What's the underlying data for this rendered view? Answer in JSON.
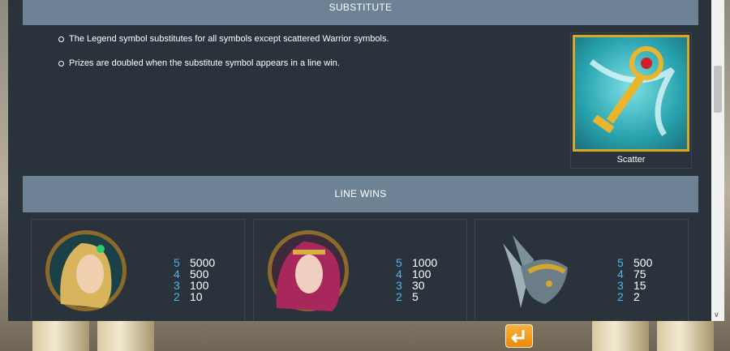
{
  "substitute": {
    "heading": "SUBSTITUTE",
    "rules": [
      "The Legend symbol substitutes for all symbols except scattered Warrior symbols.",
      "Prizes are doubled when the substitute symbol appears in a line win."
    ],
    "scatter_caption": "Scatter",
    "scatter_icon": "golden-key-icon"
  },
  "line_wins": {
    "heading": "LINE WINS",
    "symbols": [
      {
        "icon": "blonde-elf-warrior-icon",
        "pays": [
          {
            "count": "5",
            "value": "5000"
          },
          {
            "count": "4",
            "value": "500"
          },
          {
            "count": "3",
            "value": "100"
          },
          {
            "count": "2",
            "value": "10"
          }
        ]
      },
      {
        "icon": "crimson-haired-queen-icon",
        "pays": [
          {
            "count": "5",
            "value": "1000"
          },
          {
            "count": "4",
            "value": "100"
          },
          {
            "count": "3",
            "value": "30"
          },
          {
            "count": "2",
            "value": "5"
          }
        ]
      },
      {
        "icon": "winged-helmet-icon",
        "pays": [
          {
            "count": "5",
            "value": "500"
          },
          {
            "count": "4",
            "value": "75"
          },
          {
            "count": "3",
            "value": "15"
          },
          {
            "count": "2",
            "value": "2"
          }
        ]
      }
    ]
  },
  "colors": {
    "panel": "#2a323c",
    "header": "#6e8296",
    "count_accent": "#4fb3e8",
    "back_button": "#f0a020"
  }
}
